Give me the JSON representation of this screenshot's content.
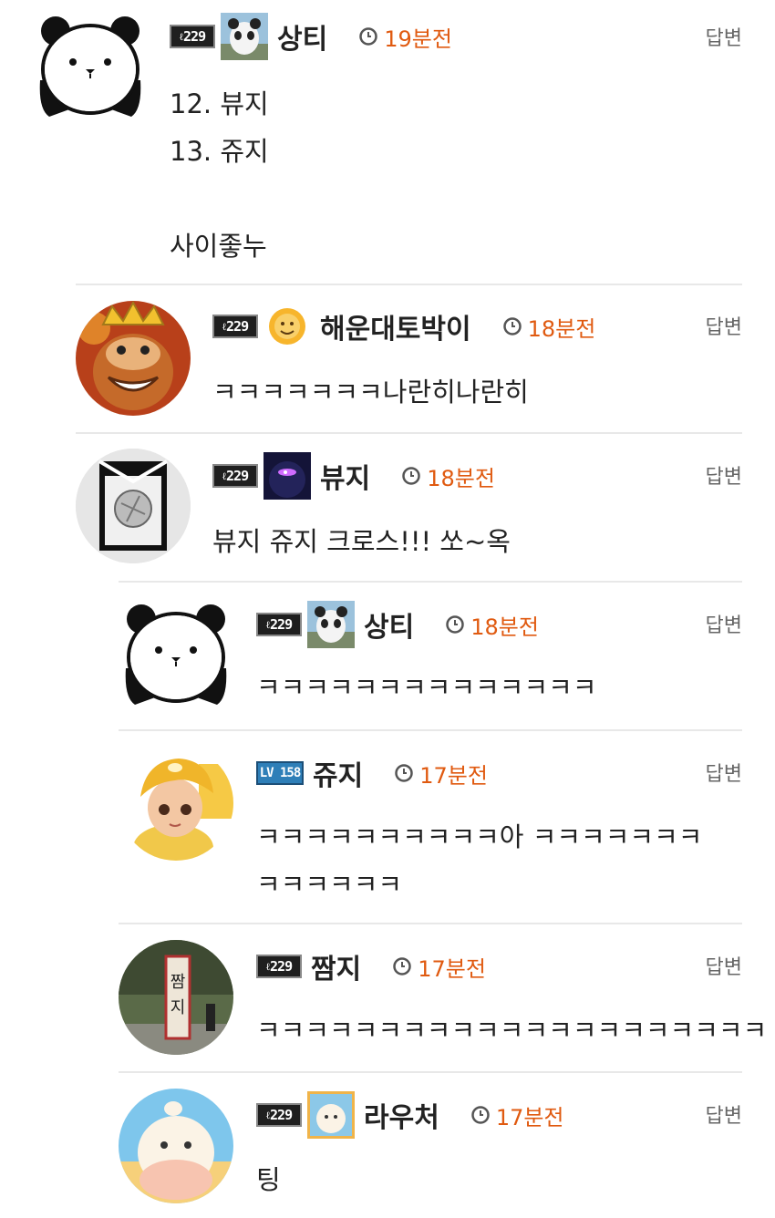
{
  "reply_label": "답변",
  "comments": [
    {
      "level": "229",
      "nickname": "상티",
      "time": "19분전",
      "lines": [
        "12. 뷰지",
        "13. 쥬지",
        "",
        "사이좋누"
      ]
    },
    {
      "level": "229",
      "nickname": "해운대토박이",
      "time": "18분전",
      "lines": [
        "ㅋㅋㅋㅋㅋㅋㅋ나란히나란히"
      ]
    },
    {
      "level": "229",
      "nickname": "뷰지",
      "time": "18분전",
      "lines": [
        "뷰지 쥬지 크로스!!! 쏘~옥"
      ]
    },
    {
      "level": "229",
      "nickname": "상티",
      "time": "18분전",
      "lines": [
        "ㅋㅋㅋㅋㅋㅋㅋㅋㅋㅋㅋㅋㅋㅋ"
      ]
    },
    {
      "level": "LV 158",
      "nickname": "쥬지",
      "time": "17분전",
      "lines": [
        "ㅋㅋㅋㅋㅋㅋㅋㅋㅋㅋ아 ㅋㅋㅋㅋㅋㅋㅋ",
        "ㅋㅋㅋㅋㅋㅋ"
      ]
    },
    {
      "level": "229",
      "nickname": "짬지",
      "time": "17분전",
      "lines": [
        "ㅋㅋㅋㅋㅋㅋㅋㅋㅋㅋㅋㅋㅋㅋㅋㅋㅋㅋㅋㅋㅋ"
      ]
    },
    {
      "level": "229",
      "nickname": "라우처",
      "time": "17분전",
      "lines": [
        "팅"
      ]
    }
  ],
  "avatar_sign_text": "짬지",
  "colors": {
    "time": "#e05a10",
    "separator": "#e8e8e8",
    "reply": "#666666",
    "text": "#222222"
  }
}
